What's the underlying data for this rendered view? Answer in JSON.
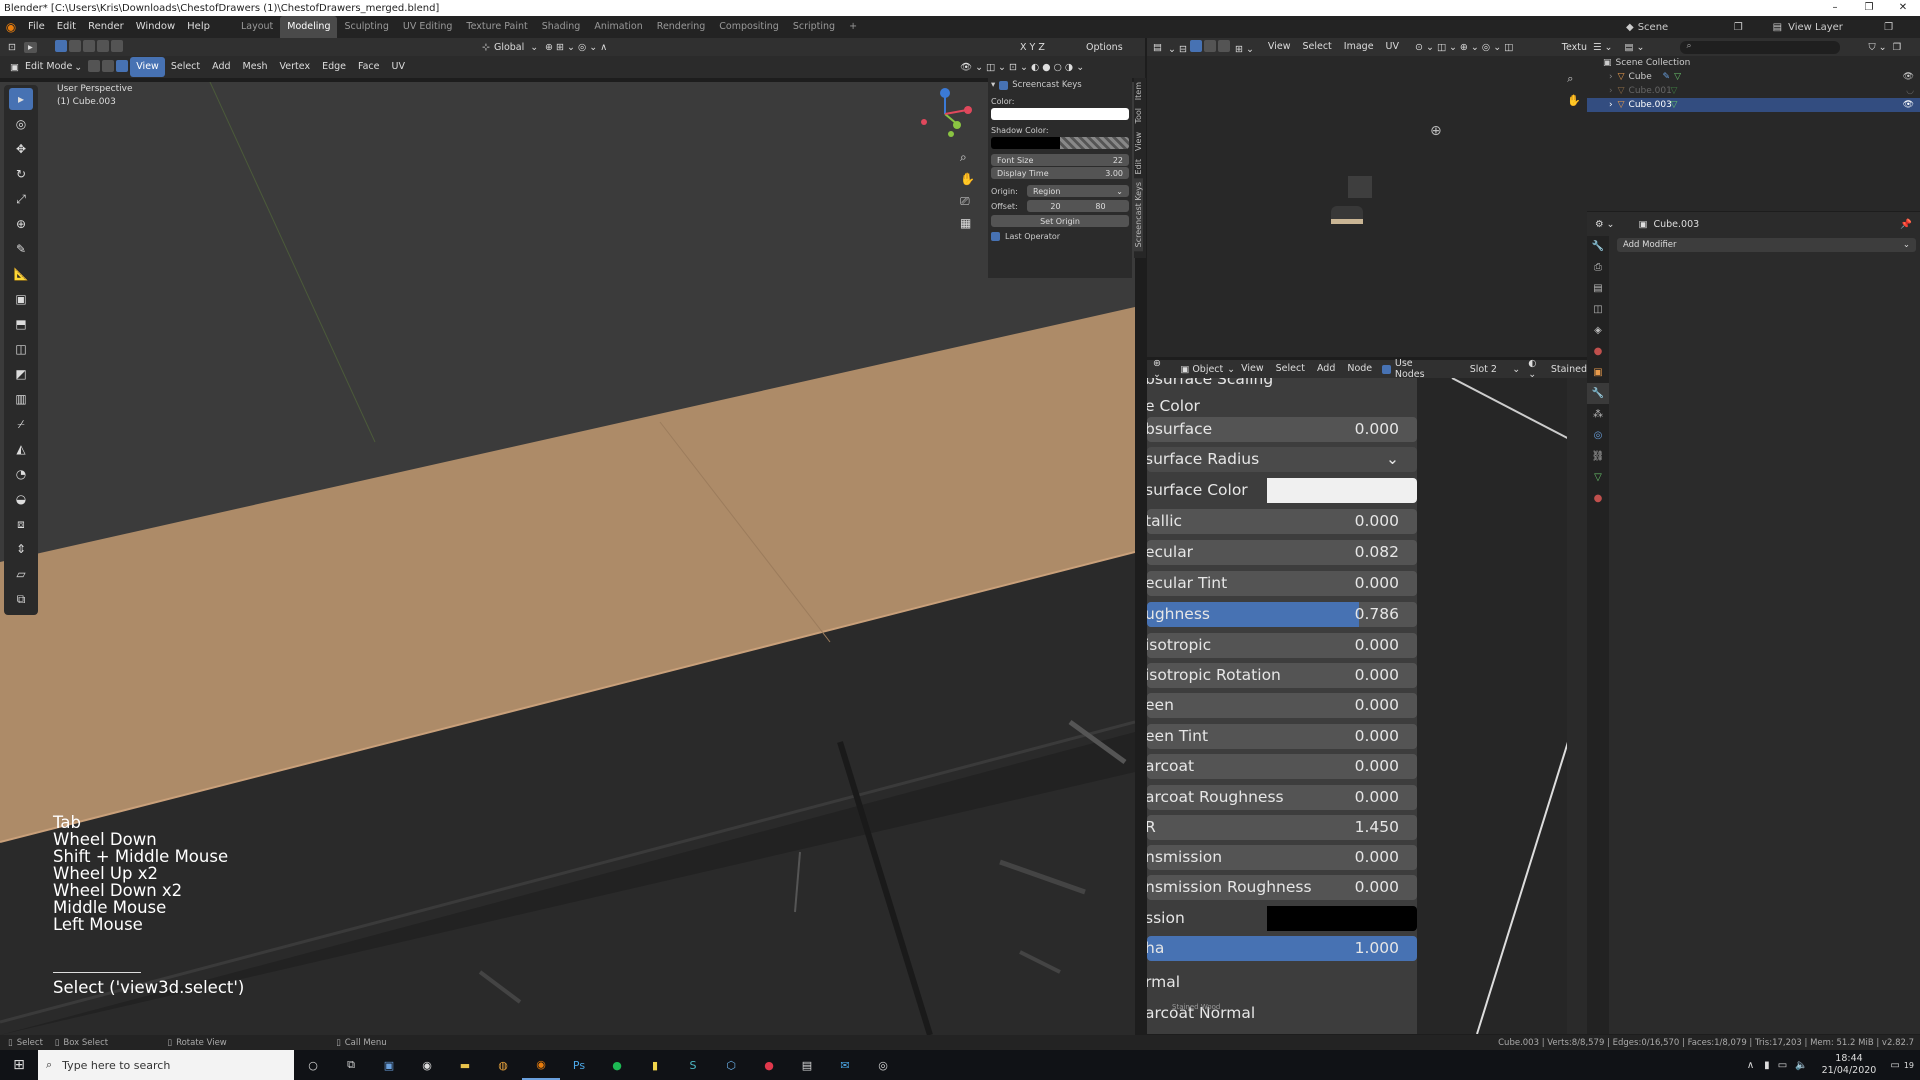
{
  "window": {
    "title": "Blender* [C:\\Users\\Kris\\Downloads\\ChestofDrawers (1)\\ChestofDrawers_merged.blend]",
    "minimize": "–",
    "maximize": "❐",
    "close": "✕"
  },
  "menubar": {
    "menus": [
      "File",
      "Edit",
      "Render",
      "Window",
      "Help"
    ],
    "workspaces": [
      "Layout",
      "Modeling",
      "Sculpting",
      "UV Editing",
      "Texture Paint",
      "Shading",
      "Animation",
      "Rendering",
      "Compositing",
      "Scripting",
      "+"
    ],
    "active_workspace": "Modeling",
    "scene": "Scene",
    "view_layer": "View Layer"
  },
  "viewport_header": {
    "mode": "Edit Mode",
    "menus": [
      "View",
      "Select",
      "Add",
      "Mesh",
      "Vertex",
      "Edge",
      "Face",
      "UV"
    ],
    "active_menu": "View",
    "transform_orientation": "Global",
    "axes": "X Y Z",
    "options": "Options"
  },
  "viewport": {
    "perspective": "User Perspective",
    "object": "(1) Cube.003"
  },
  "screencast_panel": {
    "title": "Screencast Keys",
    "color_label": "Color:",
    "shadow_color_label": "Shadow Color:",
    "font_size_label": "Font Size",
    "font_size_value": "22",
    "display_time_label": "Display Time",
    "display_time_value": "3.00",
    "origin_label": "Origin:",
    "origin_value": "Region",
    "offset_label": "Offset:",
    "offset_x": "20",
    "offset_y": "80",
    "set_origin": "Set Origin",
    "last_operator": "Last Operator"
  },
  "sidebar_tabs": [
    "Item",
    "Tool",
    "View",
    "Edit",
    "Screencast Keys"
  ],
  "screencast_keys": [
    "Tab",
    "Wheel Down",
    "Shift + Middle Mouse",
    "Wheel Up x2",
    "Wheel Down x2",
    "Middle Mouse",
    "Left Mouse"
  ],
  "last_operator_text": "Select ('view3d.select')",
  "image_editor": {
    "menus": [
      "View",
      "Select",
      "Image",
      "UV"
    ],
    "extra": "Textu"
  },
  "shader_editor": {
    "header": {
      "object": "Object",
      "menus": [
        "View",
        "Select",
        "Add",
        "Node"
      ],
      "use_nodes": "Use Nodes",
      "slot": "Slot 2",
      "material": "Stained"
    },
    "top_cut_label": "bsurface Scaling",
    "base_color_label": "e Color",
    "properties": [
      {
        "label": "bsurface",
        "value": "0.000"
      },
      {
        "label": "surface Radius",
        "value": "⌄"
      },
      {
        "label": "surface Color",
        "value": ""
      },
      {
        "label": "tallic",
        "value": "0.000"
      },
      {
        "label": "ecular",
        "value": "0.082"
      },
      {
        "label": "ecular Tint",
        "value": "0.000"
      },
      {
        "label": "ughness",
        "value": "0.786"
      },
      {
        "label": "isotropic",
        "value": "0.000"
      },
      {
        "label": "isotropic Rotation",
        "value": "0.000"
      },
      {
        "label": "een",
        "value": "0.000"
      },
      {
        "label": "een Tint",
        "value": "0.000"
      },
      {
        "label": "arcoat",
        "value": "0.000"
      },
      {
        "label": "arcoat Roughness",
        "value": "0.000"
      },
      {
        "label": "R",
        "value": "1.450"
      },
      {
        "label": "nsmission",
        "value": "0.000"
      },
      {
        "label": "nsmission Roughness",
        "value": "0.000"
      },
      {
        "label": "ssion",
        "value": ""
      },
      {
        "label": "ha",
        "value": "1.000"
      }
    ],
    "roughness_fraction": 0.786,
    "trailing_labels": [
      "rmal",
      "arcoat Normal"
    ],
    "node_frame_label": "Stained Wood"
  },
  "outliner": {
    "root": "Scene Collection",
    "items": [
      "Cube",
      "Cube.001",
      "Cube.003"
    ],
    "selected": "Cube.003"
  },
  "properties": {
    "object": "Cube.003",
    "add_modifier": "Add Modifier"
  },
  "statusbar": {
    "left": [
      "Select",
      "Box Select",
      "Rotate View",
      "Call Menu"
    ],
    "right": "Cube.003 | Verts:8/8,579 | Edges:0/16,570 | Faces:1/8,079 | Tris:17,203 | Mem: 51.2 MiB | v2.82.7"
  },
  "taskbar": {
    "search_placeholder": "Type here to search",
    "time": "18:44",
    "date": "21/04/2020",
    "notif": "19"
  },
  "colors": {
    "accent": "#4772b3",
    "surface": "#b08e6b",
    "viewport_bg": "#3b3b3b"
  }
}
